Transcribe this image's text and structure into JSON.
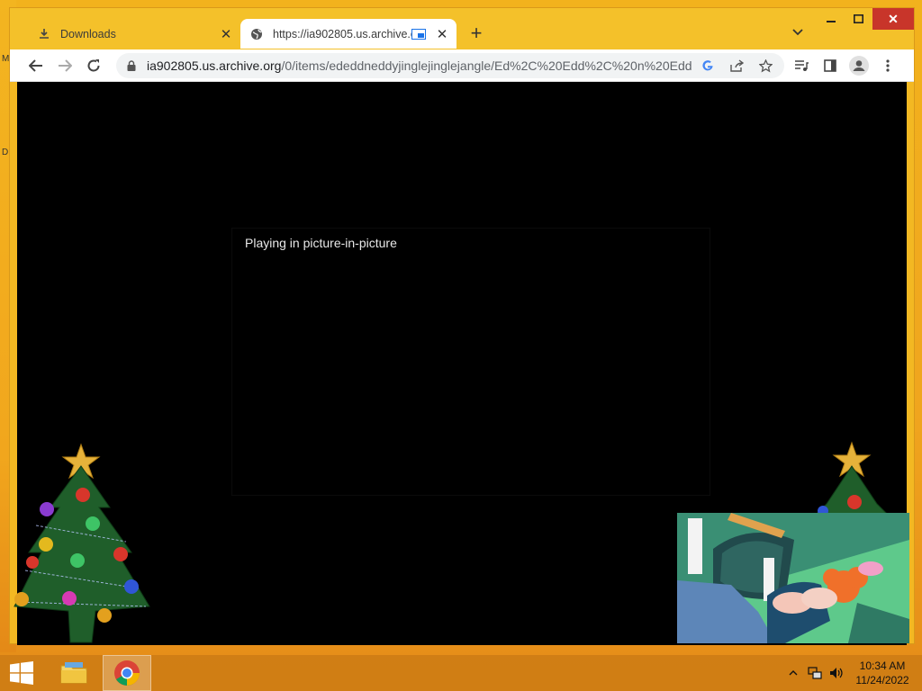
{
  "browser": {
    "tabs": [
      {
        "label": "Downloads",
        "icon": "download-icon",
        "active": false
      },
      {
        "label": "https://ia902805.us.archive.o",
        "icon": "globe-icon",
        "active": true
      }
    ],
    "address": {
      "host": "ia902805.us.archive.org",
      "path": "/0/items/ededdneddyjinglejinglejangle/Ed%2C%20Edd%2C%20n%20Edd..."
    },
    "accent_color": "#1a73e8"
  },
  "page": {
    "message": "Playing in picture-in-picture"
  },
  "taskbar": {
    "time": "10:34 AM",
    "date": "11/24/2022"
  },
  "desktop": {
    "edge_letters": [
      "M",
      "D"
    ]
  },
  "colors": {
    "title_bar": "#f4c12a",
    "close_button": "#c8352a",
    "page_background": "#000000"
  }
}
